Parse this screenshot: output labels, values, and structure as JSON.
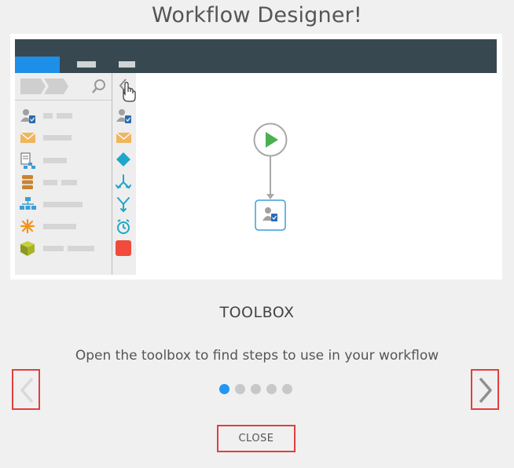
{
  "dialog": {
    "title": "Workflow Designer!"
  },
  "slide": {
    "heading": "TOOLBOX",
    "description": "Open the toolbox to find steps to use in your workflow"
  },
  "pagination": {
    "total": 5,
    "active_index": 0
  },
  "footer": {
    "close_label": "CLOSE"
  },
  "colors": {
    "accent": "#2196f3",
    "highlight_border": "#e0403c",
    "topbar": "#374850",
    "start_green": "#4caf50",
    "mail_orange": "#f0b65c"
  },
  "icons": {
    "prev": "chevron-left-icon",
    "next": "chevron-right-icon"
  }
}
